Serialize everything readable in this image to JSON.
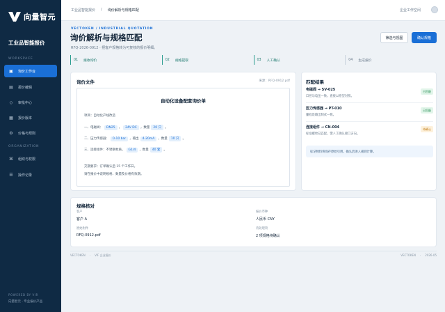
{
  "sidebar": {
    "brand": "向量智元",
    "app_title": "工业品智能报价",
    "section_workspace": "WORKSPACE",
    "section_org": "ORGANIZATION",
    "items": [
      {
        "label": "询价工作台",
        "icon": "inbox-icon"
      },
      {
        "label": "报价编辑",
        "icon": "document-icon"
      },
      {
        "label": "审批中心",
        "icon": "approval-icon"
      },
      {
        "label": "报价版本",
        "icon": "versions-icon"
      },
      {
        "label": "价格与规则",
        "icon": "rules-icon"
      },
      {
        "label": "组织与权限",
        "icon": "org-icon"
      },
      {
        "label": "操作记录",
        "icon": "log-icon"
      }
    ],
    "footer_powered": "POWERED BY VIR",
    "footer_product": "向量智元 · 专业报价产品"
  },
  "topbar": {
    "breadcrumb_root": "工业品智能报价",
    "breadcrumb_sep": "/",
    "breadcrumb_current": "询价解析与规格匹配",
    "workspace": "企业工作空间"
  },
  "header": {
    "eyebrow": "VECTOKEN / INDUSTRIAL QUOTATION",
    "title": "询价解析与规格匹配",
    "subtitle": "RFQ-2026-0912 · 把客户规格转为可复核的报价明细。",
    "btn_filter": "筛选与视图",
    "btn_confirm": "确认规格"
  },
  "steps": [
    {
      "num": "01",
      "label": "接收询价",
      "state": "done"
    },
    {
      "num": "02",
      "label": "规格提取",
      "state": "done"
    },
    {
      "num": "03",
      "label": "人工确认",
      "state": "done"
    },
    {
      "num": "04",
      "label": "生成报价",
      "state": "todo"
    }
  ],
  "doc": {
    "title": "询价文件",
    "source": "来源：RFQ-0912.pdf",
    "heading": "自动化设备配套询价单",
    "project": "项目：自动化产线改造",
    "line1": {
      "prefix": "一、电磁阀：",
      "tags": [
        "DN25",
        "24V DC"
      ],
      "mid": "，数量",
      "qty": "20 只",
      "end": "。"
    },
    "line2": {
      "prefix": "二、压力传感器：",
      "tags": [
        "0-10 bar",
        "4-20mA"
      ],
      "label_out": "，输出",
      "mid": "，数量",
      "qty": "10 只",
      "end": "。"
    },
    "line3": {
      "prefix": "三、连接组件：不锈钢材质，",
      "tags": [
        "G1/4"
      ],
      "mid": "，数量",
      "qty": "40 套",
      "end": "。"
    },
    "delivery": "交期要求：订单确认后 15 个工作日。",
    "remark": "请在报价中说明规格、数量及价格有效期。"
  },
  "match": {
    "title": "匹配结果",
    "items": [
      {
        "title": "电磁阀 → SV-025",
        "desc": "口径与电压一致，直接以原型对照。",
        "badge": "已匹配",
        "status": "ok"
      },
      {
        "title": "压力传感器 → PT-010",
        "desc": "量程及输出制式一致。",
        "badge": "已匹配",
        "status": "ok"
      },
      {
        "title": "连接组件 → CN-004",
        "desc": "标准螺纹已匹配，需人工确认接口方向。",
        "badge": "待确认",
        "status": "warn"
      }
    ],
    "note": "标记物料将保存原始引用，确认后进入规则计算。"
  },
  "spec": {
    "title": "规格核对",
    "customer_label": "客户",
    "customer_value": "客户 A",
    "currency_label": "报价币种",
    "currency_value": "人民币 CNY",
    "file_label": "原始附件",
    "file_value": "RFQ-0912.pdf",
    "pending_label": "待处理项",
    "pending_value": "2 项规格待确认"
  },
  "footer": {
    "brand": "VECTOKEN",
    "sep": "·",
    "product": "VIF 企业报价",
    "right_brand": "VECTOKEN",
    "right_date": "2026-05"
  },
  "colors": {
    "accent": "#1a6fd6",
    "sidebar": "#0f2a44",
    "done": "#2a9d8f",
    "ok": "#1e8a4d",
    "warn": "#c07a12"
  }
}
